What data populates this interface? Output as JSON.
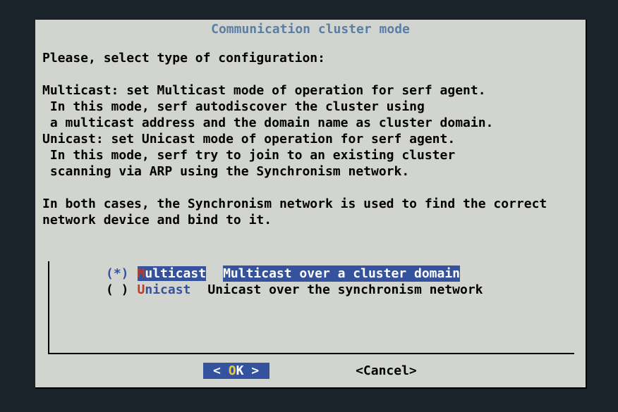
{
  "title": "Communication cluster mode",
  "intro": "Please, select type of configuration:",
  "multicast_heading": "Multicast: set Multicast mode of operation for serf agent.",
  "multicast_line1": " In this mode, serf autodiscover the cluster using",
  "multicast_line2": " a multicast address and the domain name as cluster domain.",
  "unicast_heading": "Unicast: set Unicast mode of operation for serf agent.",
  "unicast_line1": " In this mode, serf try to join to an existing cluster",
  "unicast_line2": " scanning via ARP using the Synchronism network.",
  "footer_line1": "In both cases, the Synchronism network is used to find the correct",
  "footer_line2": "network device and bind to it.",
  "options": [
    {
      "selected": true,
      "mark": "(*)",
      "hotkey": "M",
      "label_rest": "ulticast",
      "description": "Multicast over a cluster domain"
    },
    {
      "selected": false,
      "mark": "( )",
      "hotkey": "U",
      "label_rest": "nicast",
      "description": "Unicast over the synchronism network"
    }
  ],
  "buttons": {
    "ok_open": "<  ",
    "ok_hot": "O",
    "ok_rest": "K  >",
    "cancel": "<Cancel>"
  }
}
